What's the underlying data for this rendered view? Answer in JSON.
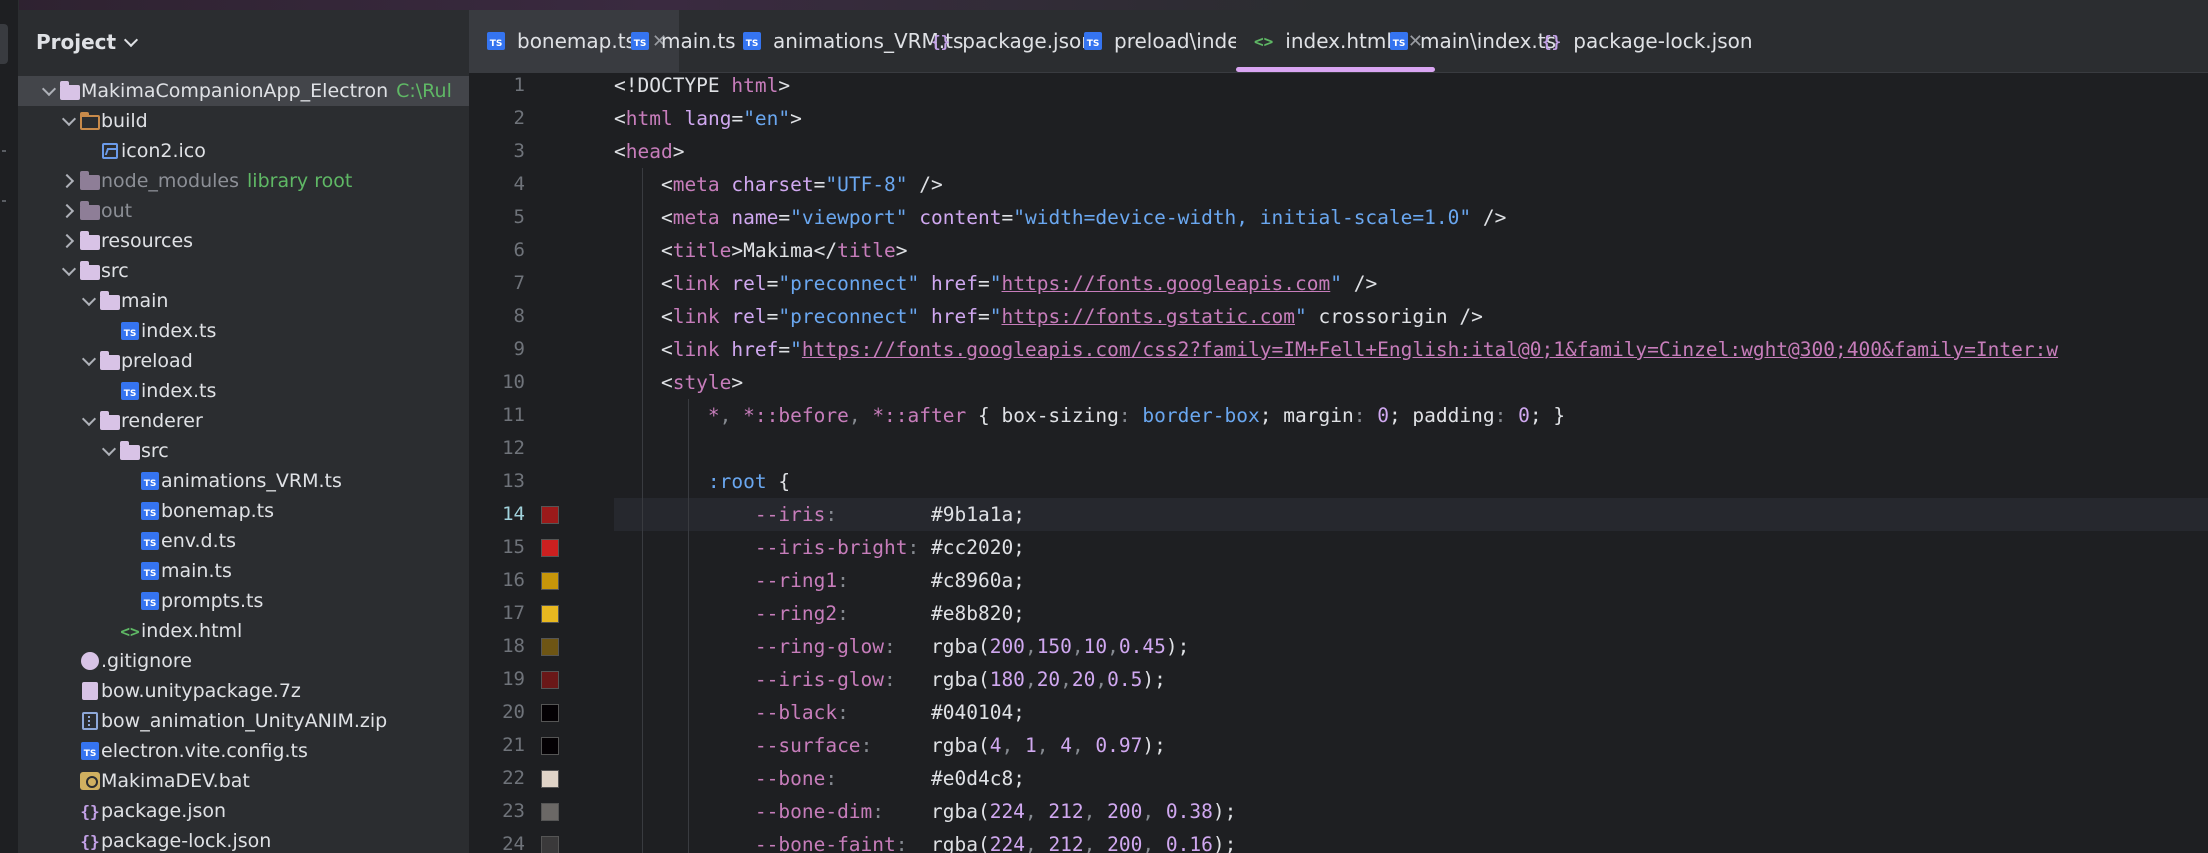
{
  "project": {
    "title": "Project",
    "tree": [
      {
        "label": "MakimaCompanionApp_Electron",
        "hint": "C:\\Rul",
        "type": "folder",
        "level": 0,
        "arrow": "down",
        "selected": true
      },
      {
        "label": "build",
        "type": "folder-orange",
        "level": 1,
        "arrow": "down"
      },
      {
        "label": "icon2.ico",
        "type": "image",
        "level": 2
      },
      {
        "label": "node_modules",
        "hint": "library root",
        "type": "folder-dim",
        "level": 1,
        "arrow": "right",
        "muted": true
      },
      {
        "label": "out",
        "type": "folder-dim",
        "level": 1,
        "arrow": "right",
        "muted": true
      },
      {
        "label": "resources",
        "type": "folder",
        "level": 1,
        "arrow": "right"
      },
      {
        "label": "src",
        "type": "folder",
        "level": 1,
        "arrow": "down"
      },
      {
        "label": "main",
        "type": "folder",
        "level": 2,
        "arrow": "down"
      },
      {
        "label": "index.ts",
        "type": "ts",
        "level": 3
      },
      {
        "label": "preload",
        "type": "folder",
        "level": 2,
        "arrow": "down"
      },
      {
        "label": "index.ts",
        "type": "ts",
        "level": 3
      },
      {
        "label": "renderer",
        "type": "folder",
        "level": 2,
        "arrow": "down"
      },
      {
        "label": "src",
        "type": "folder",
        "level": 3,
        "arrow": "down"
      },
      {
        "label": "animations_VRM.ts",
        "type": "ts",
        "level": 4
      },
      {
        "label": "bonemap.ts",
        "type": "ts",
        "level": 4
      },
      {
        "label": "env.d.ts",
        "type": "ts",
        "level": 4
      },
      {
        "label": "main.ts",
        "type": "ts",
        "level": 4
      },
      {
        "label": "prompts.ts",
        "type": "ts",
        "level": 4
      },
      {
        "label": "index.html",
        "type": "html",
        "level": 3
      },
      {
        "label": ".gitignore",
        "type": "circle",
        "level": 1
      },
      {
        "label": "bow.unitypackage.7z",
        "type": "file",
        "level": 1
      },
      {
        "label": "bow_animation_UnityANIM.zip",
        "type": "zip",
        "level": 1
      },
      {
        "label": "electron.vite.config.ts",
        "type": "ts",
        "level": 1
      },
      {
        "label": "MakimaDEV.bat",
        "type": "bat",
        "level": 1
      },
      {
        "label": "package.json",
        "type": "json",
        "level": 1
      },
      {
        "label": "package-lock.json",
        "type": "json",
        "level": 1
      }
    ]
  },
  "tabs": [
    {
      "label": "bonemap.ts",
      "icon": "ts",
      "closable": true,
      "state": "pinned"
    },
    {
      "label": "main.ts",
      "icon": "ts"
    },
    {
      "label": "animations_VRM.ts",
      "icon": "ts"
    },
    {
      "label": "package.json",
      "icon": "json"
    },
    {
      "label": "preload\\index.ts",
      "icon": "ts"
    },
    {
      "label": "index.html",
      "icon": "html",
      "closable": true,
      "state": "current"
    },
    {
      "label": "main\\index.ts",
      "icon": "ts"
    },
    {
      "label": "package-lock.json",
      "icon": "json"
    }
  ],
  "editor": {
    "current_line": 14,
    "lines": [
      {
        "n": "1",
        "parts": [
          [
            "h-plain",
            "<!DOCTYPE "
          ],
          [
            "h-tag",
            "html"
          ],
          [
            "h-plain",
            ">"
          ]
        ]
      },
      {
        "n": "2",
        "parts": [
          [
            "h-plain",
            "<"
          ],
          [
            "h-tag",
            "html"
          ],
          [
            "h-plain",
            " "
          ],
          [
            "h-attr",
            "lang"
          ],
          [
            "h-plain",
            "="
          ],
          [
            "h-str",
            "\"en\""
          ],
          [
            "h-plain",
            ">"
          ]
        ]
      },
      {
        "n": "3",
        "parts": [
          [
            "h-plain",
            "<"
          ],
          [
            "h-tag",
            "head"
          ],
          [
            "h-plain",
            ">"
          ]
        ]
      },
      {
        "n": "4",
        "parts": [
          [
            "h-plain",
            "    <"
          ],
          [
            "h-tag",
            "meta"
          ],
          [
            "h-plain",
            " "
          ],
          [
            "h-attr",
            "charset"
          ],
          [
            "h-plain",
            "="
          ],
          [
            "h-str",
            "\"UTF-8\""
          ],
          [
            "h-plain",
            " />"
          ]
        ]
      },
      {
        "n": "5",
        "parts": [
          [
            "h-plain",
            "    <"
          ],
          [
            "h-tag",
            "meta"
          ],
          [
            "h-plain",
            " "
          ],
          [
            "h-attr",
            "name"
          ],
          [
            "h-plain",
            "="
          ],
          [
            "h-str",
            "\"viewport\""
          ],
          [
            "h-plain",
            " "
          ],
          [
            "h-attr",
            "content"
          ],
          [
            "h-plain",
            "="
          ],
          [
            "h-str",
            "\"width=device-width, initial-scale=1.0\""
          ],
          [
            "h-plain",
            " />"
          ]
        ]
      },
      {
        "n": "6",
        "parts": [
          [
            "h-plain",
            "    <"
          ],
          [
            "h-tag",
            "title"
          ],
          [
            "h-plain",
            ">Makima</"
          ],
          [
            "h-tag",
            "title"
          ],
          [
            "h-plain",
            ">"
          ]
        ]
      },
      {
        "n": "7",
        "parts": [
          [
            "h-plain",
            "    <"
          ],
          [
            "h-tag",
            "link"
          ],
          [
            "h-plain",
            " "
          ],
          [
            "h-attr",
            "rel"
          ],
          [
            "h-plain",
            "="
          ],
          [
            "h-str",
            "\"preconnect\""
          ],
          [
            "h-plain",
            " "
          ],
          [
            "h-attr",
            "href"
          ],
          [
            "h-plain",
            "="
          ],
          [
            "h-str",
            "\""
          ],
          [
            "k-link",
            "https://fonts.googleapis.com"
          ],
          [
            "h-str",
            "\""
          ],
          [
            "h-plain",
            " />"
          ]
        ]
      },
      {
        "n": "8",
        "parts": [
          [
            "h-plain",
            "    <"
          ],
          [
            "h-tag",
            "link"
          ],
          [
            "h-plain",
            " "
          ],
          [
            "h-attr",
            "rel"
          ],
          [
            "h-plain",
            "="
          ],
          [
            "h-str",
            "\"preconnect\""
          ],
          [
            "h-plain",
            " "
          ],
          [
            "h-attr",
            "href"
          ],
          [
            "h-plain",
            "="
          ],
          [
            "h-str",
            "\""
          ],
          [
            "k-link",
            "https://fonts.gstatic.com"
          ],
          [
            "h-str",
            "\""
          ],
          [
            "h-plain",
            " crossorigin />"
          ]
        ]
      },
      {
        "n": "9",
        "parts": [
          [
            "h-plain",
            "    <"
          ],
          [
            "h-tag",
            "link"
          ],
          [
            "h-plain",
            " "
          ],
          [
            "h-attr",
            "href"
          ],
          [
            "h-plain",
            "="
          ],
          [
            "h-str",
            "\""
          ],
          [
            "k-link",
            "https://fonts.googleapis.com/css2?family=IM+Fell+English:ital@0;1&family=Cinzel:wght@300;400&family=Inter:w"
          ]
        ]
      },
      {
        "n": "10",
        "parts": [
          [
            "h-plain",
            "    <"
          ],
          [
            "h-tag",
            "style"
          ],
          [
            "h-plain",
            ">"
          ]
        ]
      },
      {
        "n": "11",
        "parts": [
          [
            "h-plain",
            "        "
          ],
          [
            "h-tag",
            "*"
          ],
          [
            "k-dim",
            ", "
          ],
          [
            "h-tag",
            "*::before"
          ],
          [
            "k-dim",
            ", "
          ],
          [
            "h-tag",
            "*::after"
          ],
          [
            "h-plain",
            " { "
          ],
          [
            "h-plain",
            "box-sizing"
          ],
          [
            "k-dim",
            ": "
          ],
          [
            "h-str",
            "border-box"
          ],
          [
            "h-plain",
            "; "
          ],
          [
            "h-plain",
            "margin"
          ],
          [
            "k-dim",
            ": "
          ],
          [
            "h-attr",
            "0"
          ],
          [
            "h-plain",
            "; "
          ],
          [
            "h-plain",
            "padding"
          ],
          [
            "k-dim",
            ": "
          ],
          [
            "h-attr",
            "0"
          ],
          [
            "h-plain",
            "; }"
          ]
        ]
      },
      {
        "n": "12",
        "parts": [
          [
            "h-plain",
            ""
          ]
        ]
      },
      {
        "n": "13",
        "parts": [
          [
            "h-plain",
            "        "
          ],
          [
            "h-str",
            ":root"
          ],
          [
            "h-plain",
            " {"
          ]
        ]
      },
      {
        "n": "14",
        "sw": "#9b1a1a",
        "parts": [
          [
            "h-plain",
            "            "
          ],
          [
            "h-tag",
            "--iris"
          ],
          [
            "k-dim",
            ":        "
          ],
          [
            "h-plain",
            "#9b1a1a;"
          ]
        ]
      },
      {
        "n": "15",
        "sw": "#cc2020",
        "parts": [
          [
            "h-plain",
            "            "
          ],
          [
            "h-tag",
            "--iris-bright"
          ],
          [
            "k-dim",
            ": "
          ],
          [
            "h-plain",
            "#cc2020;"
          ]
        ]
      },
      {
        "n": "16",
        "sw": "#c8960a",
        "parts": [
          [
            "h-plain",
            "            "
          ],
          [
            "h-tag",
            "--ring1"
          ],
          [
            "k-dim",
            ":       "
          ],
          [
            "h-plain",
            "#c8960a;"
          ]
        ]
      },
      {
        "n": "17",
        "sw": "#e8b820",
        "parts": [
          [
            "h-plain",
            "            "
          ],
          [
            "h-tag",
            "--ring2"
          ],
          [
            "k-dim",
            ":       "
          ],
          [
            "h-plain",
            "#e8b820;"
          ]
        ]
      },
      {
        "n": "18",
        "sw": "#6e5514",
        "parts": [
          [
            "h-plain",
            "            "
          ],
          [
            "h-tag",
            "--ring-glow"
          ],
          [
            "k-dim",
            ":   "
          ],
          [
            "h-plain",
            "rgba("
          ],
          [
            "h-attr",
            "200"
          ],
          [
            "k-dim",
            ","
          ],
          [
            "h-attr",
            "150"
          ],
          [
            "k-dim",
            ","
          ],
          [
            "h-attr",
            "10"
          ],
          [
            "k-dim",
            ","
          ],
          [
            "h-attr",
            "0.45"
          ],
          [
            "h-plain",
            ");"
          ]
        ]
      },
      {
        "n": "19",
        "sw": "#6a1818",
        "parts": [
          [
            "h-plain",
            "            "
          ],
          [
            "h-tag",
            "--iris-glow"
          ],
          [
            "k-dim",
            ":   "
          ],
          [
            "h-plain",
            "rgba("
          ],
          [
            "h-attr",
            "180"
          ],
          [
            "k-dim",
            ","
          ],
          [
            "h-attr",
            "20"
          ],
          [
            "k-dim",
            ","
          ],
          [
            "h-attr",
            "20"
          ],
          [
            "k-dim",
            ","
          ],
          [
            "h-attr",
            "0.5"
          ],
          [
            "h-plain",
            ");"
          ]
        ]
      },
      {
        "n": "20",
        "sw": "#040104",
        "parts": [
          [
            "h-plain",
            "            "
          ],
          [
            "h-tag",
            "--black"
          ],
          [
            "k-dim",
            ":       "
          ],
          [
            "h-plain",
            "#040104;"
          ]
        ]
      },
      {
        "n": "21",
        "sw": "#040104",
        "parts": [
          [
            "h-plain",
            "            "
          ],
          [
            "h-tag",
            "--surface"
          ],
          [
            "k-dim",
            ":     "
          ],
          [
            "h-plain",
            "rgba("
          ],
          [
            "h-attr",
            "4"
          ],
          [
            "k-dim",
            ", "
          ],
          [
            "h-attr",
            "1"
          ],
          [
            "k-dim",
            ", "
          ],
          [
            "h-attr",
            "4"
          ],
          [
            "k-dim",
            ", "
          ],
          [
            "h-attr",
            "0.97"
          ],
          [
            "h-plain",
            ");"
          ]
        ]
      },
      {
        "n": "22",
        "sw": "#e0d4c8",
        "parts": [
          [
            "h-plain",
            "            "
          ],
          [
            "h-tag",
            "--bone"
          ],
          [
            "k-dim",
            ":        "
          ],
          [
            "h-plain",
            "#e0d4c8;"
          ]
        ]
      },
      {
        "n": "23",
        "sw": "#6b6866",
        "parts": [
          [
            "h-plain",
            "            "
          ],
          [
            "h-tag",
            "--bone-dim"
          ],
          [
            "k-dim",
            ":    "
          ],
          [
            "h-plain",
            "rgba("
          ],
          [
            "h-attr",
            "224"
          ],
          [
            "k-dim",
            ", "
          ],
          [
            "h-attr",
            "212"
          ],
          [
            "k-dim",
            ", "
          ],
          [
            "h-attr",
            "200"
          ],
          [
            "k-dim",
            ", "
          ],
          [
            "h-attr",
            "0.38"
          ],
          [
            "h-plain",
            ");"
          ]
        ]
      },
      {
        "n": "24",
        "sw": "#3a393a",
        "parts": [
          [
            "h-plain",
            "            "
          ],
          [
            "h-tag",
            "--bone-faint"
          ],
          [
            "k-dim",
            ":  "
          ],
          [
            "h-plain",
            "rgba("
          ],
          [
            "h-attr",
            "224"
          ],
          [
            "k-dim",
            ", "
          ],
          [
            "h-attr",
            "212"
          ],
          [
            "k-dim",
            ", "
          ],
          [
            "h-attr",
            "200"
          ],
          [
            "k-dim",
            ", "
          ],
          [
            "h-attr",
            "0.16"
          ],
          [
            "h-plain",
            ");"
          ]
        ]
      }
    ]
  }
}
